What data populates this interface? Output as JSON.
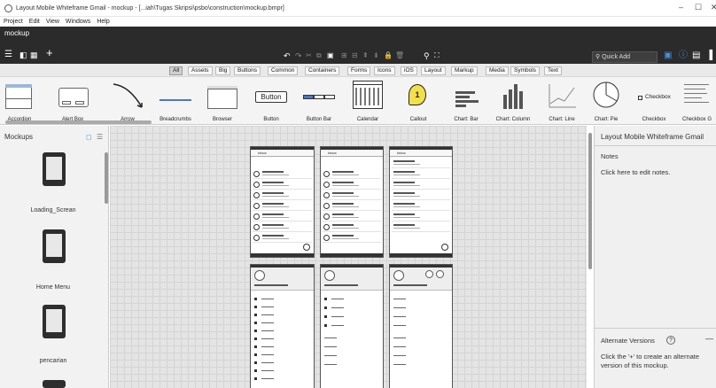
{
  "window": {
    "title": "Layout Mobile Whiteframe Gmail - mockup - [...iah\\Tugas Skripsi\\psbo\\construction\\mockup.bmpr]",
    "controls": [
      "–",
      "☐",
      "✕"
    ]
  },
  "menu": [
    "Project",
    "Edit",
    "View",
    "Windows",
    "Help"
  ],
  "project_name": "mockup",
  "search": {
    "placeholder": "Quick Add"
  },
  "filters": {
    "items": [
      "All",
      "Assets",
      "Big",
      "Buttons",
      "Common",
      "Containers",
      "Forms",
      "Icons",
      "iOS",
      "Layout",
      "Markup",
      "Media",
      "Symbols",
      "Text"
    ],
    "selected": "All"
  },
  "library": [
    {
      "label": "Accordion"
    },
    {
      "label": "Alert Box"
    },
    {
      "label": "Arrow"
    },
    {
      "label": "Breadcrumbs"
    },
    {
      "label": "Browser"
    },
    {
      "label": "Button",
      "preview_text": "Button"
    },
    {
      "label": "Button Bar"
    },
    {
      "label": "Calendar"
    },
    {
      "label": "Callout",
      "preview_text": "1"
    },
    {
      "label": "Chart: Bar"
    },
    {
      "label": "Chart: Column"
    },
    {
      "label": "Chart: Line"
    },
    {
      "label": "Chart: Pie"
    },
    {
      "label": "Checkbox",
      "preview_text": "Checkbox"
    },
    {
      "label": "Checkbox G"
    }
  ],
  "mockups_panel": {
    "title": "Mockups",
    "items": [
      {
        "label": "Loading_Screan"
      },
      {
        "label": "Home Menu"
      },
      {
        "label": "pencarian"
      }
    ]
  },
  "canvas": {
    "inbox_title": "Inbox"
  },
  "right_panel": {
    "title": "Layout Mobile Whiteframe Gmail",
    "notes_label": "Notes",
    "notes_hint": "Click here to edit notes.",
    "versions_label": "Alternate Versions",
    "versions_hint_1": "Click the '+' to create an alternate",
    "versions_hint_2": "version of this mockup."
  },
  "colors": {
    "toolbar_bg": "#2b2b2b",
    "accent": "#4a90d9",
    "canvas_bg": "#e4e4e4"
  }
}
